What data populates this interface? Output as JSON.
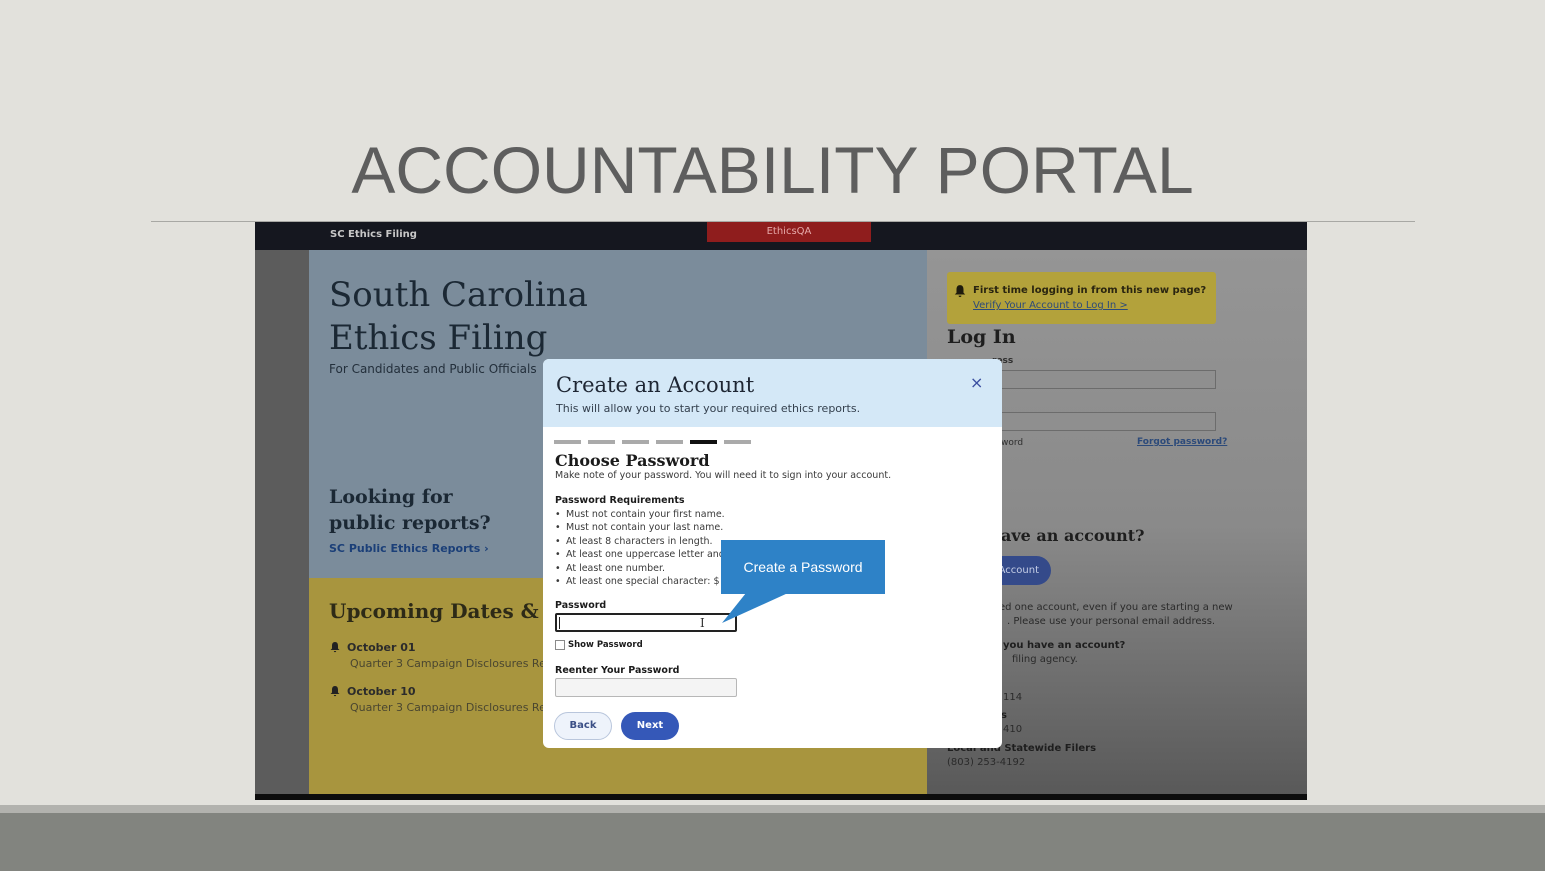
{
  "slide": {
    "title": "ACCOUNTABILITY PORTAL"
  },
  "site": {
    "topbar_brand": "SC Ethics Filing",
    "topbar_env": "EthicsQA",
    "title_line1": "South Carolina",
    "title_line2": "Ethics Filing",
    "subtitle": "For Candidates and Public Officials",
    "looking_line1": "Looking for",
    "looking_line2": "public reports?",
    "public_link": "SC Public Ethics Reports  ›",
    "upcoming_heading": "Upcoming Dates & De",
    "dates": [
      {
        "date": "October 01",
        "desc": "Quarter 3 Campaign Disclosures Repor"
      },
      {
        "date": "October 10",
        "desc": "Quarter 3 Campaign Disclosures Repor"
      }
    ]
  },
  "login": {
    "notice_title": "First time logging in from this new page?",
    "notice_link": "Verify Your Account to Log In >",
    "heading": "Log In",
    "email_label": "ress",
    "remember_label": "word",
    "forgot_link": "Forgot password?",
    "no_account_heading": "ave an account?",
    "create_button": "Account",
    "info_line1": "ed one account, even if you are starting a new",
    "info_line2": ". Please use your personal email address.",
    "have_account": "you have an account?",
    "filing_agency": "filing agency.",
    "phone1": "114",
    "phone2_label": "s",
    "phone2": "410",
    "local_label": "Local and Statewide Filers",
    "local_phone": "(803) 253-4192"
  },
  "modal": {
    "title": "Create an Account",
    "subtitle": "This will allow you to start your required ethics reports.",
    "close": "×",
    "steps_total": 6,
    "steps_active": 5,
    "section_title": "Choose Password",
    "section_sub": "Make note of your password. You will need it to sign into your account.",
    "requirements_heading": "Password Requirements",
    "requirements": [
      "Must not contain your first name.",
      "Must not contain your last name.",
      "At least 8 characters in length.",
      "At least one uppercase letter and o",
      "At least one number.",
      "At least one special character: $ ! #"
    ],
    "password_label": "Password",
    "password_value": "",
    "show_password_label": "Show Password",
    "reenter_label": "Reenter Your Password",
    "reenter_value": "",
    "back_button": "Back",
    "next_button": "Next"
  },
  "callout": {
    "text": "Create a Password"
  },
  "colors": {
    "slide_bg": "#e2e1dc",
    "modal_header": "#d4e8f7",
    "primary_button": "#3558b8",
    "callout": "#2e82c7",
    "env_badge": "#8f1d1d"
  }
}
